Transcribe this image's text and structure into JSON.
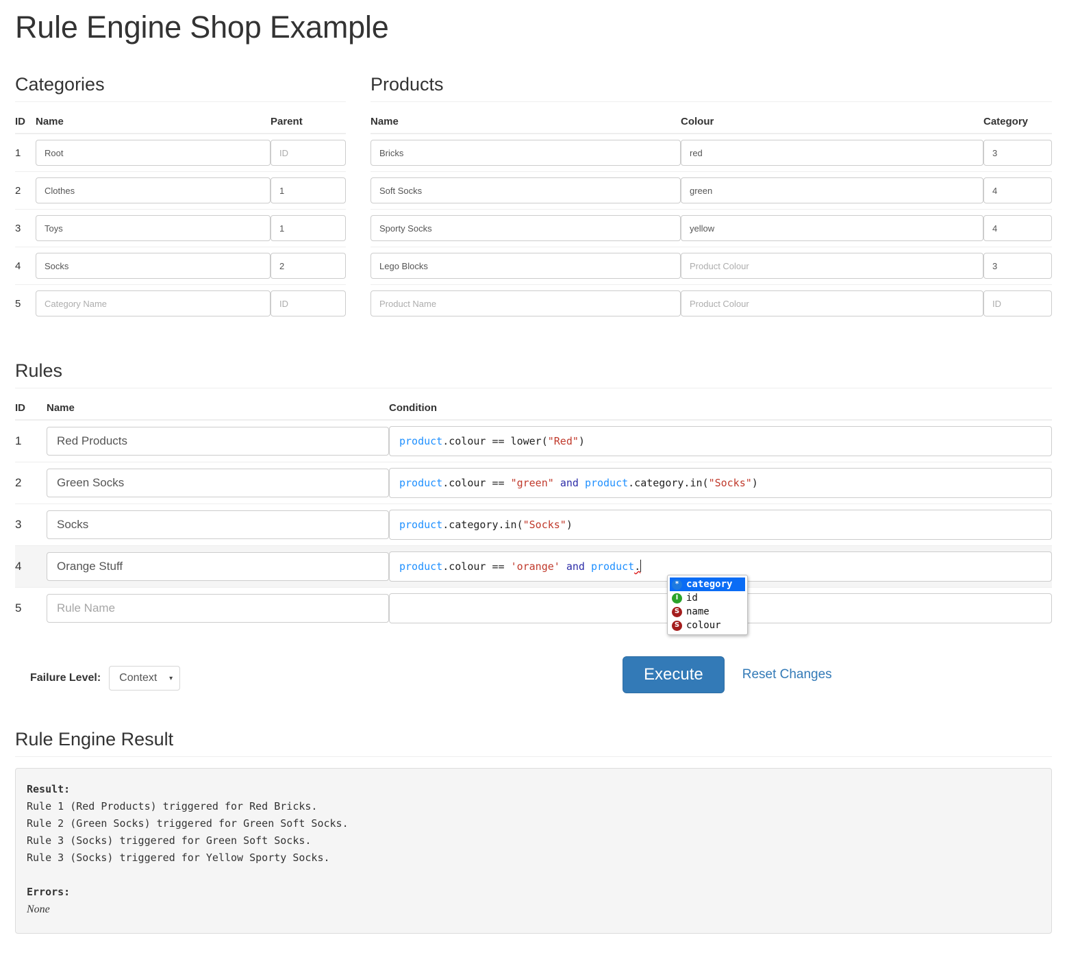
{
  "app": {
    "title": "Rule Engine Shop Example"
  },
  "categories": {
    "section_title": "Categories",
    "columns": {
      "id": "ID",
      "name": "Name",
      "parent": "Parent"
    },
    "placeholders": {
      "name": "Category Name",
      "parent": "ID"
    },
    "rows": [
      {
        "id": "1",
        "name": "Root",
        "parent": ""
      },
      {
        "id": "2",
        "name": "Clothes",
        "parent": "1"
      },
      {
        "id": "3",
        "name": "Toys",
        "parent": "1"
      },
      {
        "id": "4",
        "name": "Socks",
        "parent": "2"
      },
      {
        "id": "5",
        "name": "",
        "parent": ""
      }
    ]
  },
  "products": {
    "section_title": "Products",
    "columns": {
      "name": "Name",
      "colour": "Colour",
      "category": "Category"
    },
    "placeholders": {
      "name": "Product Name",
      "colour": "Product Colour",
      "category": "ID"
    },
    "rows": [
      {
        "name": "Bricks",
        "colour": "red",
        "category": "3"
      },
      {
        "name": "Soft Socks",
        "colour": "green",
        "category": "4"
      },
      {
        "name": "Sporty Socks",
        "colour": "yellow",
        "category": "4"
      },
      {
        "name": "Lego Blocks",
        "colour": "",
        "category": "3"
      },
      {
        "name": "",
        "colour": "",
        "category": ""
      }
    ]
  },
  "rules": {
    "section_title": "Rules",
    "columns": {
      "id": "ID",
      "name": "Name",
      "condition": "Condition"
    },
    "placeholders": {
      "name": "Rule Name"
    },
    "rows": [
      {
        "id": "1",
        "name": "Red Products",
        "condition": "product.colour == lower(\"Red\")",
        "tokens": [
          {
            "t": "product",
            "k": "var"
          },
          {
            "t": ".colour == lower(",
            "k": "op"
          },
          {
            "t": "\"Red\"",
            "k": "str"
          },
          {
            "t": ")",
            "k": "op"
          }
        ],
        "active": false
      },
      {
        "id": "2",
        "name": "Green Socks",
        "condition": "product.colour == \"green\" and product.category.in(\"Socks\")",
        "tokens": [
          {
            "t": "product",
            "k": "var"
          },
          {
            "t": ".colour == ",
            "k": "op"
          },
          {
            "t": "\"green\"",
            "k": "str"
          },
          {
            "t": " ",
            "k": "op"
          },
          {
            "t": "and",
            "k": "kw"
          },
          {
            "t": " ",
            "k": "op"
          },
          {
            "t": "product",
            "k": "var"
          },
          {
            "t": ".category.in(",
            "k": "op"
          },
          {
            "t": "\"Socks\"",
            "k": "str"
          },
          {
            "t": ")",
            "k": "op"
          }
        ],
        "active": false
      },
      {
        "id": "3",
        "name": "Socks",
        "condition": "product.category.in(\"Socks\")",
        "tokens": [
          {
            "t": "product",
            "k": "var"
          },
          {
            "t": ".category.in(",
            "k": "op"
          },
          {
            "t": "\"Socks\"",
            "k": "str"
          },
          {
            "t": ")",
            "k": "op"
          }
        ],
        "active": false
      },
      {
        "id": "4",
        "name": "Orange Stuff",
        "condition": "product.colour == 'orange' and product.",
        "tokens": [
          {
            "t": "product",
            "k": "var"
          },
          {
            "t": ".colour == ",
            "k": "op"
          },
          {
            "t": "'orange'",
            "k": "str"
          },
          {
            "t": " ",
            "k": "op"
          },
          {
            "t": "and",
            "k": "kw"
          },
          {
            "t": " ",
            "k": "op"
          },
          {
            "t": "product",
            "k": "var"
          },
          {
            "t": ".",
            "k": "err"
          }
        ],
        "active": true,
        "caret": true
      },
      {
        "id": "5",
        "name": "",
        "condition": "",
        "tokens": [],
        "active": false
      }
    ]
  },
  "autocomplete": {
    "items": [
      {
        "label": "category",
        "badge": "*",
        "badge_kind": "star",
        "selected": true
      },
      {
        "label": "id",
        "badge": "I",
        "badge_kind": "int",
        "selected": false
      },
      {
        "label": "name",
        "badge": "S",
        "badge_kind": "str",
        "selected": false
      },
      {
        "label": "colour",
        "badge": "S",
        "badge_kind": "str",
        "selected": false
      }
    ]
  },
  "controls": {
    "failure_level_label": "Failure Level:",
    "failure_level_value": "Context",
    "failure_level_arrow": "▾",
    "execute_label": "Execute",
    "reset_label": "Reset Changes"
  },
  "result": {
    "section_title": "Rule Engine Result",
    "result_heading": "Result:",
    "lines": [
      "Rule 1 (Red Products) triggered for Red Bricks.",
      "Rule 2 (Green Socks) triggered for Green Soft Socks.",
      "Rule 3 (Socks) triggered for Green Soft Socks.",
      "Rule 3 (Socks) triggered for Yellow Sporty Socks."
    ],
    "errors_heading": "Errors:",
    "errors_value": "None"
  },
  "colors": {
    "accent": "#337ab7",
    "token_var": "#1f90ff",
    "token_str": "#c0392b",
    "token_kw": "#2d2da8",
    "ac_selected": "#0a6cf5",
    "badge_star": "#1e7ae0",
    "badge_int": "#2aa32a",
    "badge_str": "#a41d1d"
  }
}
